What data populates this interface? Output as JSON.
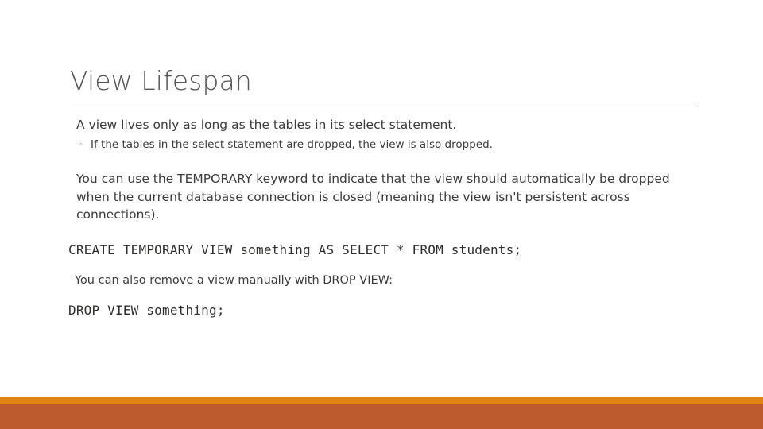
{
  "slide": {
    "title": "View Lifespan",
    "body": {
      "line1": "A view lives only as long as the tables in its select statement.",
      "sub_bullet_marker": "◦",
      "sub_bullet": "If the tables in the select statement are dropped, the view is also dropped.",
      "paragraph": "You can use the TEMPORARY keyword to indicate that the view should automatically be dropped when the current database connection is closed (meaning the view isn't persistent across connections).",
      "code_create": "CREATE TEMPORARY VIEW something AS SELECT * FROM students;",
      "note": "You can also remove a view manually with DROP VIEW:",
      "code_drop": "DROP VIEW something;"
    },
    "colors": {
      "title_text": "#565656",
      "body_text": "#3b3b39",
      "code_text": "#2f2f2d",
      "rule": "#7f7f7f",
      "bullet_marker": "#a38560",
      "footer_accent": "#e08214",
      "footer_band": "#bd5a2e",
      "background": "#ffffff"
    }
  }
}
